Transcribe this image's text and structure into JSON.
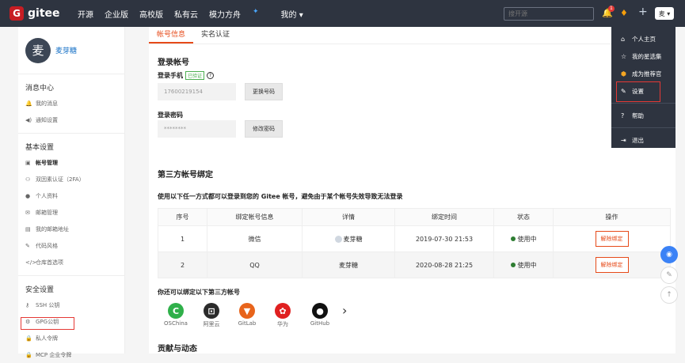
{
  "header": {
    "logo_text": "gitee",
    "nav": [
      "开源",
      "企业版",
      "高校版",
      "私有云",
      "模力方舟",
      "我的 ▾"
    ],
    "search_placeholder": "搜开源",
    "notification_count": "1",
    "user_short": "麦 ▾"
  },
  "sidebar": {
    "username": "麦芽糖",
    "avatar_char": "麦",
    "groups": [
      {
        "title": "消息中心",
        "items": [
          "我的消息",
          "通知设置"
        ]
      },
      {
        "title": "基本设置",
        "items": [
          "帐号管理",
          "双因素认证（2FA）",
          "个人资料",
          "邮箱管理",
          "我的邮箱地址",
          "代码风格",
          "仓库首选项"
        ]
      },
      {
        "title": "安全设置",
        "items": [
          "SSH 公钥",
          "GPG公钥",
          "私人令牌",
          "MCP 企业令牌"
        ]
      }
    ]
  },
  "tabs": [
    "帐号信息",
    "实名认证"
  ],
  "login": {
    "title": "登录帐号",
    "phone_label": "登录手机",
    "verified": "已验证",
    "phone": "17600219154",
    "change_phone": "更换号码",
    "pwd_label": "登录密码",
    "pwd": "********",
    "change_pwd": "修改密码"
  },
  "third": {
    "title": "第三方帐号绑定",
    "desc": "使用以下任一方式都可以登录到您的 Gitee 帐号，避免由于某个帐号失效导致无法登录",
    "columns": [
      "序号",
      "绑定帐号信息",
      "详情",
      "绑定时间",
      "状态",
      "操作"
    ],
    "rows": [
      {
        "no": "1",
        "account": "微信",
        "detail": "麦芽糖",
        "time": "2019-07-30 21:53",
        "status": "使用中",
        "action": "解除绑定"
      },
      {
        "no": "2",
        "account": "QQ",
        "detail": "麦芽糖",
        "time": "2020-08-28 21:25",
        "status": "使用中",
        "action": "解除绑定"
      }
    ],
    "more_title": "你还可以绑定以下第三方帐号",
    "platforms": [
      {
        "name": "OSChina",
        "color": "#2fb04a",
        "glyph": "C"
      },
      {
        "name": "阿里云",
        "color": "#2b2b2b",
        "glyph": "⊡"
      },
      {
        "name": "GitLab",
        "color": "#e8641b",
        "glyph": "▼"
      },
      {
        "name": "华为",
        "color": "#e02020",
        "glyph": "✿"
      },
      {
        "name": "GitHub",
        "color": "#111111",
        "glyph": "●"
      }
    ]
  },
  "contrib_title": "贡献与动态",
  "menu": [
    "个人主页",
    "我的星选集",
    "成为推荐官",
    "设置",
    "帮助",
    "退出"
  ]
}
